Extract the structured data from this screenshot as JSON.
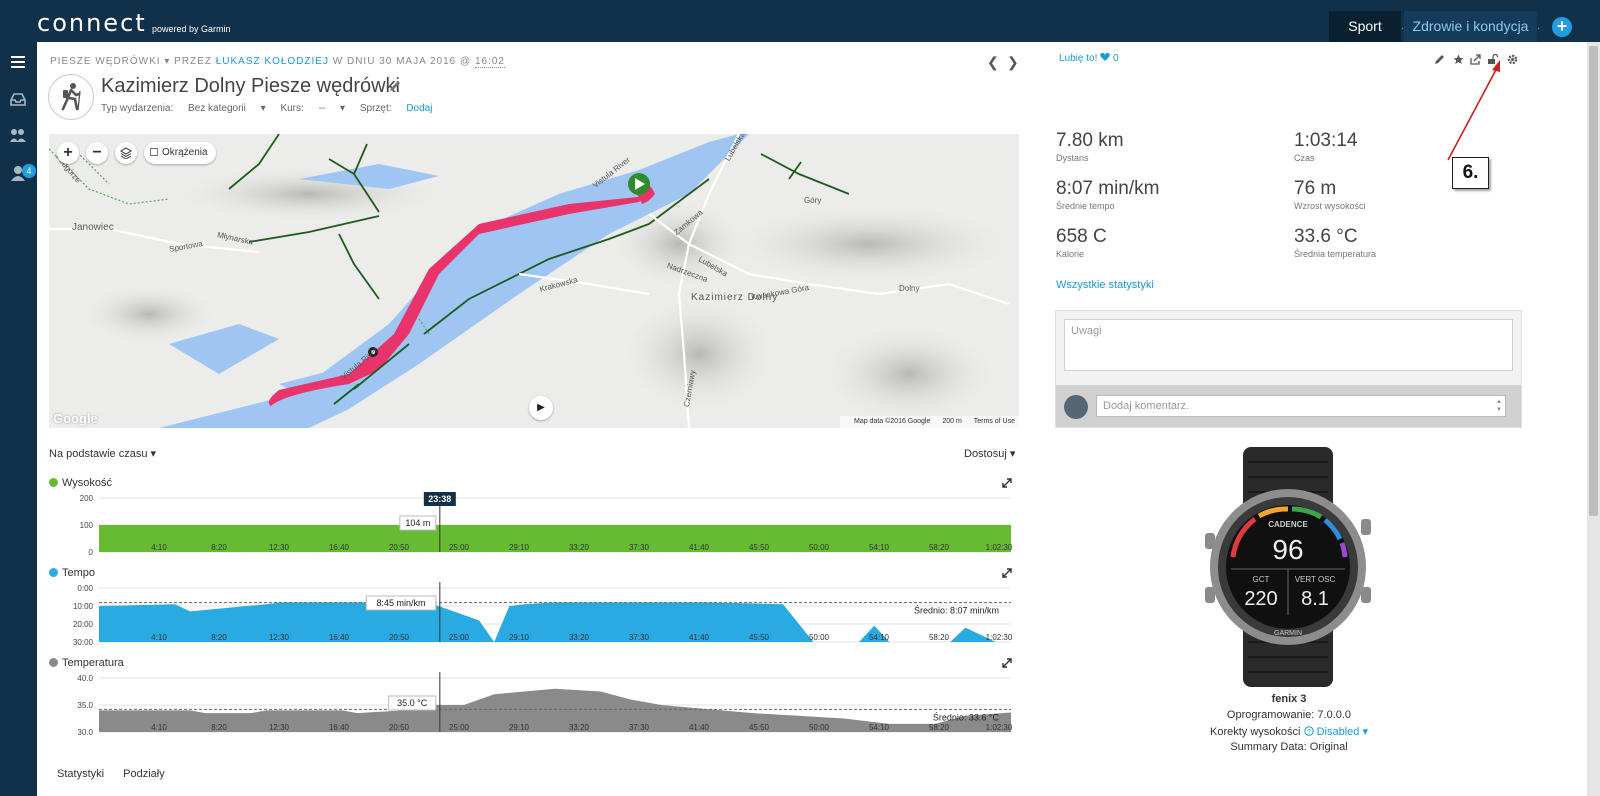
{
  "app": {
    "logo": "connect",
    "logo_sub": "powered by Garmin"
  },
  "top_tabs": {
    "sport": "Sport",
    "separator": ".",
    "health": "Zdrowie i kondycja",
    "plus": "+"
  },
  "leftnav": {
    "badge_count": "4",
    "icons": [
      "menu-icon",
      "inbox-icon",
      "connections-icon",
      "profile-icon"
    ]
  },
  "activity": {
    "breadcrumb_type": "PIESZE WĘDRÓWKI",
    "breadcrumb_by": "PRZEZ",
    "breadcrumb_user": "ŁUKASZ KOŁODZIEJ",
    "breadcrumb_on": "W DNIU 30 MAJA 2016 @",
    "breadcrumb_time": "16:02",
    "title": "Kazimierz Dolny Piesze wędrówki",
    "event_type_label": "Typ wydarzenia:",
    "event_type_value": "Bez kategorii",
    "course_label": "Kurs:",
    "course_value": "--",
    "gear_label": "Sprzęt:",
    "gear_value": "Dodaj"
  },
  "map": {
    "laps_label": "Okrążenia",
    "zoom_in": "+",
    "zoom_out": "−",
    "labels": [
      "Janowiec",
      "Kazimierz Dolny",
      "Vistula River",
      "Krakowska",
      "Nadrzeczna",
      "Lubelska",
      "Kwaskowa Góra",
      "Góry",
      "Dolny",
      "Sportowa",
      "Młynarska",
      "Zamkowa",
      "Czerniawy",
      "Lubelska",
      "Podgórze"
    ],
    "attribution": "Map data ©2016 Google",
    "scale": "200 m",
    "terms": "Terms of Use",
    "google": "Google"
  },
  "charts": {
    "basis": "Na podstawie czasu",
    "adjust": "Dostosuj",
    "cursor_time": "23:38",
    "x_ticks": [
      "4:10",
      "8:20",
      "12:30",
      "16:40",
      "20:50",
      "25:00",
      "29:10",
      "33:20",
      "37:30",
      "41:40",
      "45:50",
      "50:00",
      "54:10",
      "58:20",
      "1:02:30"
    ]
  },
  "chart_data": [
    {
      "type": "area",
      "title": "Wysokość",
      "color": "#66bb33",
      "y_ticks": [
        "200",
        "100",
        "0"
      ],
      "ylim": [
        0,
        200
      ],
      "x": [
        0,
        60
      ],
      "values": [
        100,
        100
      ],
      "tooltip": "104 m"
    },
    {
      "type": "area",
      "title": "Tempo",
      "color": "#29aae1",
      "y_ticks": [
        "0:00",
        "10:00",
        "20:00",
        "30:00"
      ],
      "ylim": [
        0,
        30
      ],
      "inverted": true,
      "x": [
        0,
        5,
        6,
        11,
        12,
        18,
        19,
        22,
        23,
        25,
        26,
        27,
        28,
        30,
        40,
        45,
        47,
        48,
        50,
        51,
        52,
        54,
        55,
        56,
        57,
        59,
        60
      ],
      "values": [
        10,
        9,
        13,
        9,
        8,
        8,
        9,
        9,
        12,
        18,
        30,
        10,
        9,
        8,
        8,
        9,
        30,
        30,
        30,
        21,
        30,
        30,
        30,
        30,
        22,
        30,
        30
      ],
      "average_label": "Średnio: 8:07 min/km",
      "average": 8.1,
      "tooltip": "8:45 min/km"
    },
    {
      "type": "area",
      "title": "Temperatura",
      "color": "#8a8a8a",
      "y_ticks": [
        "40.0",
        "35.0",
        "30.0"
      ],
      "ylim": [
        30,
        40
      ],
      "x": [
        0,
        6,
        7,
        10,
        11,
        16,
        17,
        20,
        21,
        23,
        24,
        25,
        26,
        28,
        30,
        33,
        35,
        37,
        39,
        41,
        43,
        46,
        49,
        52,
        55,
        57,
        60
      ],
      "values": [
        34,
        34,
        33.5,
        33.5,
        34,
        34,
        33.5,
        34,
        35,
        35,
        35,
        36,
        37,
        37.5,
        38,
        37.5,
        36,
        35,
        34.5,
        34,
        33.5,
        33,
        32.5,
        31.5,
        31.5,
        33,
        33.6
      ],
      "average_label": "Średnio: 33.6 °C",
      "average": 34.2,
      "tooltip": "35.0 °C"
    }
  ],
  "bottom_tabs": [
    "Statystyki",
    "Podziały"
  ],
  "social": {
    "like": "Lubię to!",
    "like_count": "0"
  },
  "stats": [
    {
      "value": "7.80 km",
      "label": "Dystans"
    },
    {
      "value": "1:03:14",
      "label": "Czas"
    },
    {
      "value": "8:07 min/km",
      "label": "Średnie tempo"
    },
    {
      "value": "76 m",
      "label": "Wzrost wysokości"
    },
    {
      "value": "658 C",
      "label": "Kalorie"
    },
    {
      "value": "33.6 °C",
      "label": "Średnia temperatura"
    }
  ],
  "all_stats_link": "Wszystkie statystyki",
  "notes_placeholder": "Uwagi",
  "comment_placeholder": "Dodaj komentarz.",
  "device": {
    "name": "fenix 3",
    "software": "Oprogramowanie: 7.0.0.0",
    "elevation_label": "Korekty wysokości",
    "elevation_value": "Disabled",
    "summary": "Summary Data: Original",
    "watch_cadence_label": "CADENCE",
    "watch_cadence": "96",
    "watch_gct_label": "GCT",
    "watch_gct": "220",
    "watch_vo_label": "VERT OSC",
    "watch_vo": "8.1",
    "watch_brand": "GARMIN"
  },
  "annotation": {
    "callout": "6.",
    "arrow_color": "#cc1f1f"
  },
  "colors": {
    "accent": "#1a9ad6",
    "nav": "#11314b",
    "route": "#e8336b"
  }
}
